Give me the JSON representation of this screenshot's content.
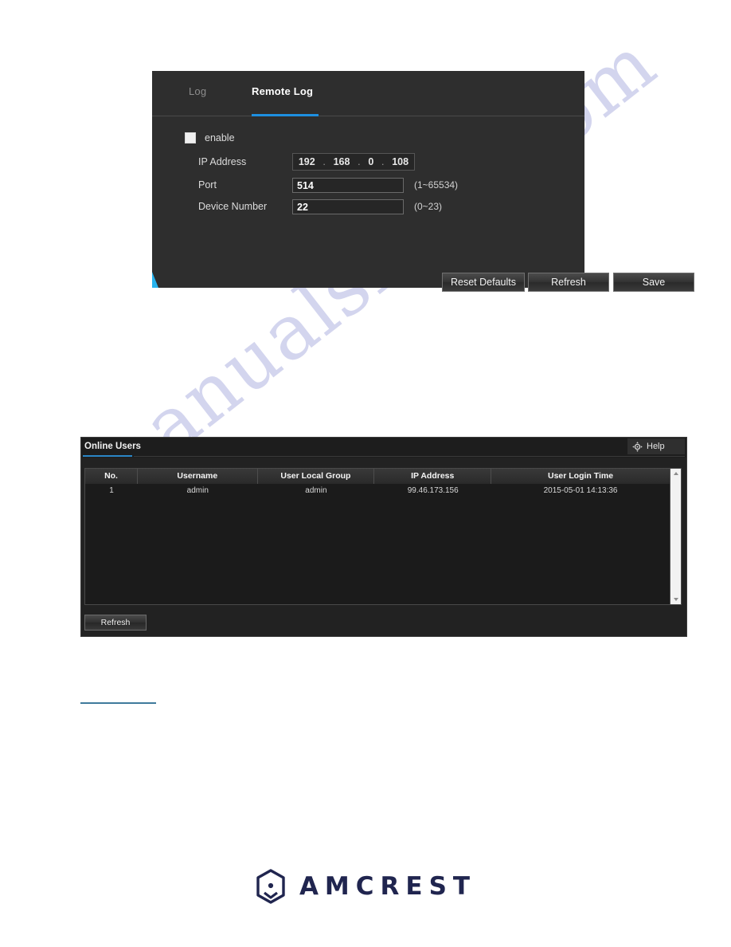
{
  "watermark": {
    "text": "manualshive.com"
  },
  "remote_log_panel": {
    "tabs": [
      {
        "label": "Log",
        "active": false
      },
      {
        "label": "Remote Log",
        "active": true
      }
    ],
    "enable": {
      "label": "enable",
      "checked": false
    },
    "fields": [
      {
        "label": "IP Address",
        "type": "ip",
        "segments": [
          "192",
          "168",
          "0",
          "108"
        ],
        "separator": ".",
        "hint": ""
      },
      {
        "label": "Port",
        "type": "text",
        "value": "514",
        "hint": "(1~65534)"
      },
      {
        "label": "Device Number",
        "type": "text",
        "value": "22",
        "hint": "(0~23)"
      }
    ],
    "buttons": [
      {
        "label": "Reset Defaults"
      },
      {
        "label": "Refresh"
      },
      {
        "label": "Save"
      }
    ],
    "accent_color": "#1e8fe0"
  },
  "online_users_panel": {
    "title": "Online Users",
    "help": {
      "label": "Help",
      "icon": "compass-help-icon"
    },
    "table": {
      "columns": [
        "No.",
        "Username",
        "User Local Group",
        "IP Address",
        "User Login Time"
      ],
      "rows": [
        [
          "1",
          "admin",
          "admin",
          "99.46.173.156",
          "2015-05-01 14:13:36"
        ]
      ]
    },
    "refresh_button": {
      "label": "Refresh"
    },
    "accent_color": "#2b86c6"
  },
  "brand": {
    "name": "AMCREST",
    "mark": "hexagon-dot-logo",
    "color": "#20254f"
  }
}
